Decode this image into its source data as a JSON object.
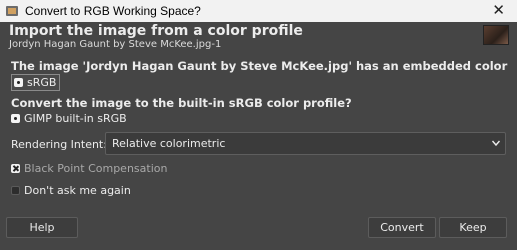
{
  "window": {
    "title": "Convert to RGB Working Space?"
  },
  "header": {
    "title": "Import the image from a color profile",
    "subtitle": "Jordyn Hagan Gaunt by Steve McKee.jpg-1"
  },
  "message": {
    "embedded_text": "The image 'Jordyn Hagan Gaunt by Steve McKee.jpg' has an embedded color profile",
    "embedded_profile": "sRGB",
    "convert_question": "Convert the image to the built-in sRGB color profile?",
    "builtin_profile": "GIMP built-in sRGB"
  },
  "rendering_intent": {
    "label": "Rendering Intent:",
    "value": "Relative colorimetric"
  },
  "options": {
    "black_point": {
      "label": "Black Point Compensation",
      "checked": true,
      "enabled": false
    },
    "dont_ask": {
      "label": "Don't ask me again",
      "checked": false
    }
  },
  "buttons": {
    "help": "Help",
    "convert": "Convert",
    "keep": "Keep"
  },
  "icons": {
    "app": "gimp-app-icon",
    "close": "close-icon",
    "thumbnail": "image-thumbnail",
    "profile": "profile-bullet-icon",
    "dropdown": "chevron-down-icon"
  }
}
